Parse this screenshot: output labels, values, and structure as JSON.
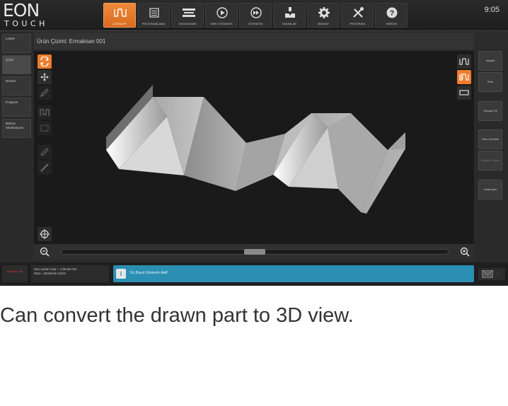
{
  "logo": {
    "line1": "EON",
    "line2": "TOUCH"
  },
  "clock": "9:05",
  "top_nav": [
    {
      "label": "ÇİZİMLER",
      "icon": "profile-icon",
      "active": true
    },
    {
      "label": "PROGRAMLAMA",
      "icon": "list-icon",
      "active": false
    },
    {
      "label": "TAKIM AYARI",
      "icon": "tooling-icon",
      "active": false
    },
    {
      "label": "YARI OTOMATİK",
      "icon": "play-icon",
      "active": false
    },
    {
      "label": "OTOMATİK",
      "icon": "fast-forward-icon",
      "active": false
    },
    {
      "label": "TAKIMLAR",
      "icon": "punch-die-icon",
      "active": false
    },
    {
      "label": "MAKİNE",
      "icon": "gear-icon",
      "active": false
    },
    {
      "label": "PROGRAM",
      "icon": "tools-icon",
      "active": false
    },
    {
      "label": "YARDIM",
      "icon": "help-icon",
      "active": false
    }
  ],
  "sidebar": {
    "items": [
      {
        "label": "Listele"
      },
      {
        "label": "Çizim"
      },
      {
        "label": "Növerk"
      },
      {
        "label": "Program"
      },
      {
        "label": "Bükme Simülasyonu"
      }
    ],
    "alert": "Bağlantı yok"
  },
  "page_title": "Ürün Çizimi: Ermaksan 001",
  "right_panel": [
    {
      "label": "Kaydet",
      "dim": false
    },
    {
      "label": "Ekle",
      "dim": false
    },
    {
      "label": "Parçayı Sil",
      "dim": false
    },
    {
      "label": "Ürün Çevrileri",
      "dim": false
    },
    {
      "label": "Ölçüleri Göster",
      "dim": true
    },
    {
      "label": "Kaba Ayar",
      "dim": false
    }
  ],
  "status": {
    "info_line1": "Son Açılan Ayar = 1.88,85 mm",
    "info_line2": "Mod = Düzlemle Çizim",
    "message": "Üç Boyut Gösterim Aktif"
  },
  "caption": "Can convert the drawn part to 3D view."
}
